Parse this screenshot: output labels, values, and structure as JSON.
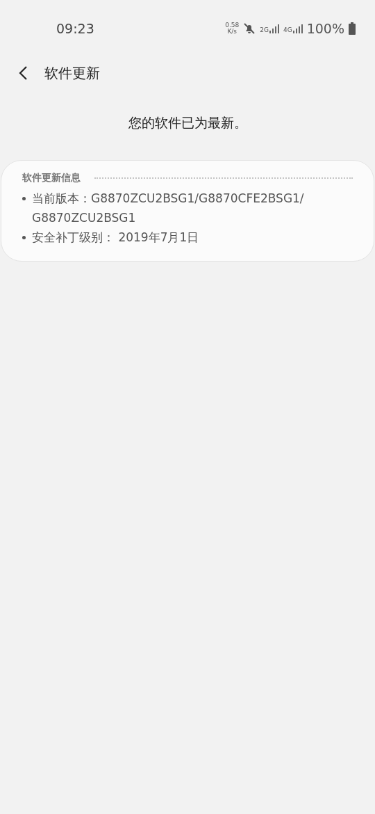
{
  "status_bar": {
    "time": "09:23",
    "speed_value": "0.58",
    "speed_unit": "K/s",
    "network_1": "2G",
    "network_2": "4G",
    "battery": "100%"
  },
  "header": {
    "title": "软件更新"
  },
  "message": "您的软件已为最新。",
  "info_card": {
    "heading": "软件更新信息",
    "items": [
      "当前版本：G8870ZCU2BSG1/G8870CFE2BSG1/\nG8870ZCU2BSG1",
      "安全补丁级别： 2019年7月1日"
    ]
  }
}
